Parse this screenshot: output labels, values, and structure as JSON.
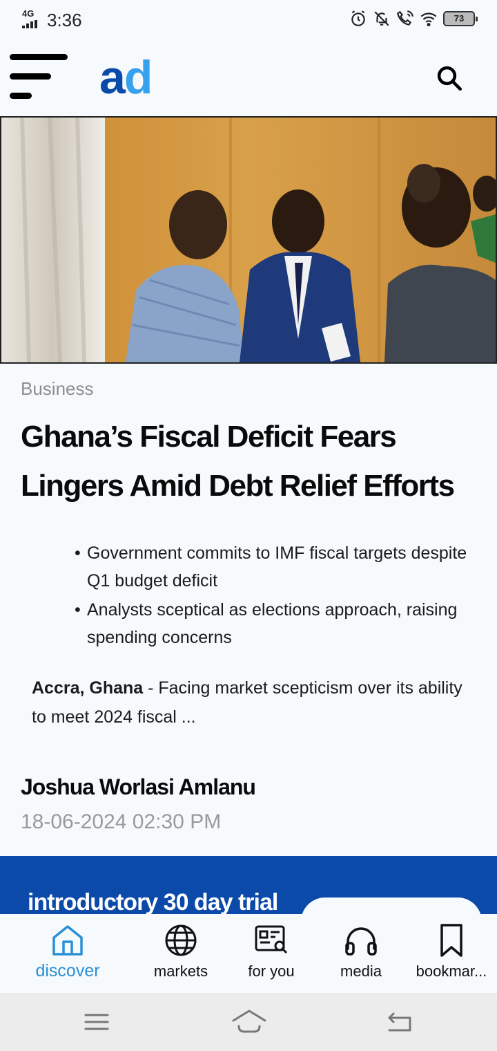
{
  "status_bar": {
    "network": "4G",
    "time": "3:36",
    "battery": "73"
  },
  "header": {
    "logo_part1": "a",
    "logo_part2": "d"
  },
  "article": {
    "category": "Business",
    "headline": "Ghana’s Fiscal Deficit Fears Lingers Amid Debt Relief Efforts",
    "bullets": [
      "Government commits to IMF fiscal targets despite Q1 budget deficit",
      "Analysts sceptical as elections approach, raising spending concerns"
    ],
    "lede_place": "Accra, Ghana",
    "lede_text": " - Facing market scepticism over its ability to meet 2024 fiscal ...",
    "author": "Joshua Worlasi Amlanu",
    "date": "18-06-2024 02:30 PM"
  },
  "promo": {
    "text": "introductory 30 day trial"
  },
  "bottom_nav": {
    "items": [
      {
        "label": "discover",
        "icon": "home-icon",
        "active": true
      },
      {
        "label": "markets",
        "icon": "globe-icon"
      },
      {
        "label": "for you",
        "icon": "news-search-icon"
      },
      {
        "label": "media",
        "icon": "headphones-icon"
      },
      {
        "label": "bookmar...",
        "icon": "bookmark-icon"
      }
    ]
  },
  "colors": {
    "brand_dark": "#0a4aa8",
    "brand_light": "#38a1ee",
    "active_nav": "#2b8fd6",
    "promo_bg": "#0b4aa8"
  }
}
